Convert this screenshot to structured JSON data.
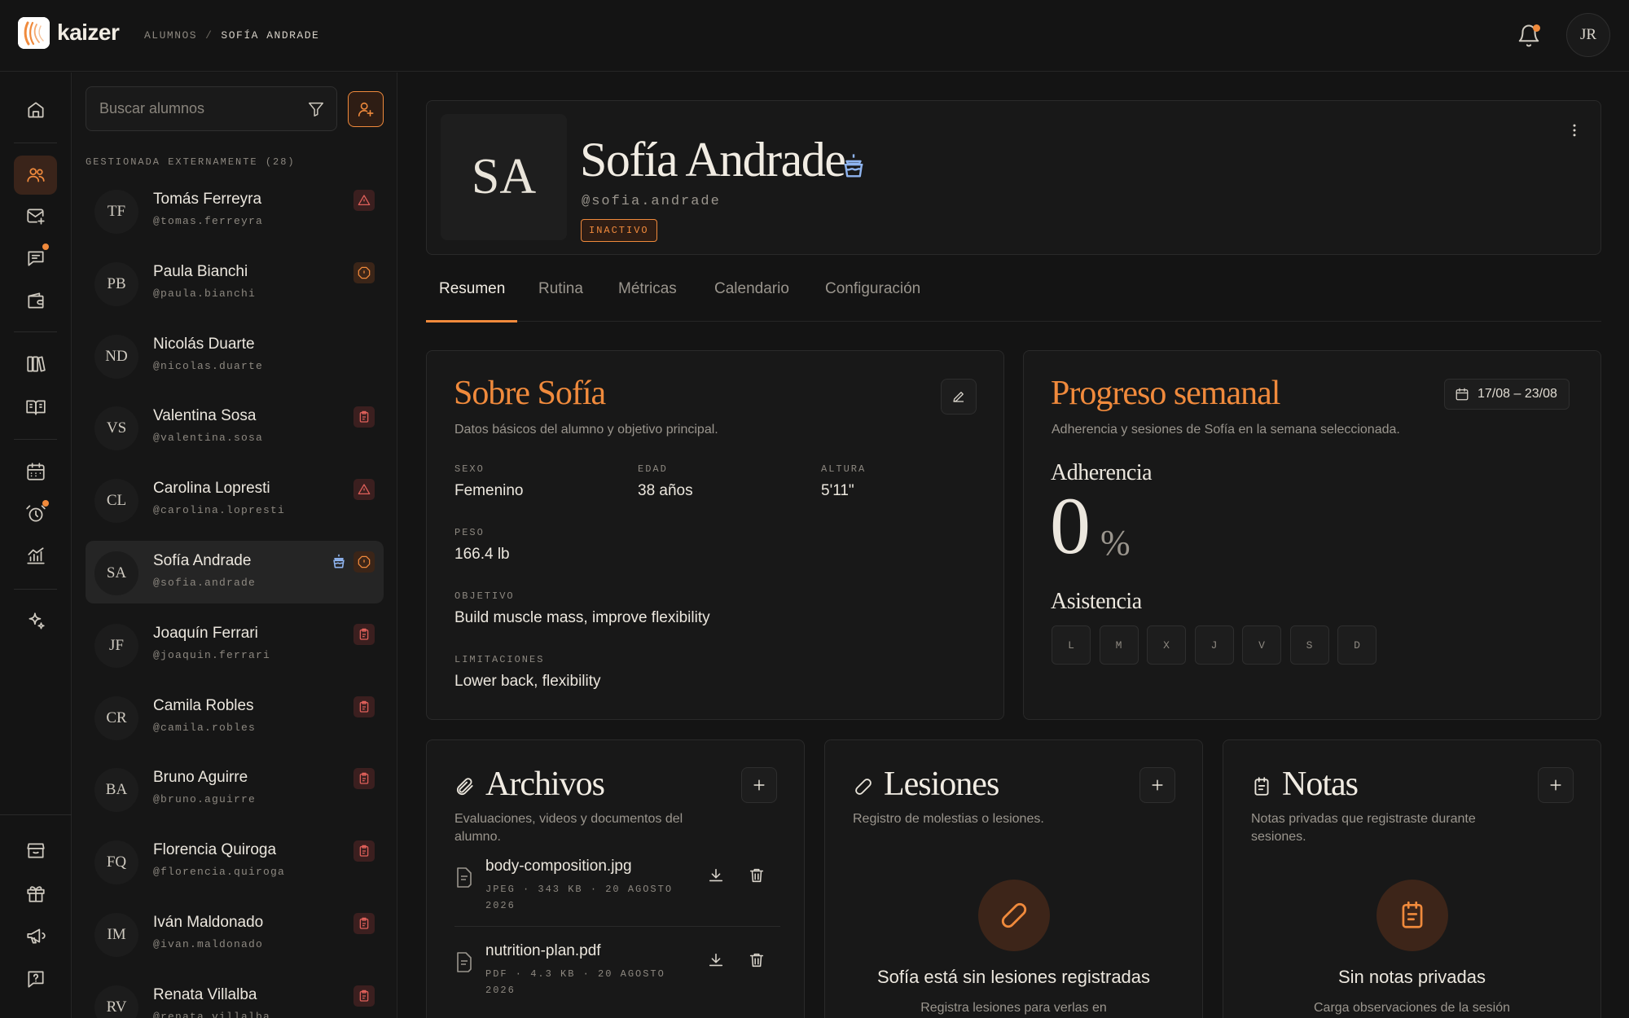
{
  "app": {
    "logo_text": "kaizer",
    "breadcrumb": [
      "ALUMNOS",
      "SOFÍA ANDRADE"
    ],
    "breadcrumb_sep": "/",
    "user_initials": "JR",
    "accent_color": "#f08a3c"
  },
  "rail": {
    "icons": [
      "home-icon",
      "users-icon",
      "mail-plus-icon",
      "chat-icon",
      "wallet-icon",
      "book-icon",
      "book-open-icon",
      "calendar-icon",
      "alarm-icon",
      "chart-icon",
      "sparkle-icon",
      "store-icon",
      "gift-icon",
      "megaphone-icon",
      "help-icon"
    ]
  },
  "students": {
    "search_placeholder": "Buscar alumnos",
    "section_label": "GESTIONADA EXTERNAMENTE (28)",
    "items": [
      {
        "initials": "TF",
        "name": "Tomás Ferreyra",
        "handle": "@tomas.ferreyra",
        "badge": "warning-icon"
      },
      {
        "initials": "PB",
        "name": "Paula Bianchi",
        "handle": "@paula.bianchi",
        "badge": "alert-icon"
      },
      {
        "initials": "ND",
        "name": "Nicolás Duarte",
        "handle": "@nicolas.duarte",
        "badge": ""
      },
      {
        "initials": "VS",
        "name": "Valentina Sosa",
        "handle": "@valentina.sosa",
        "badge": "clipboard-icon"
      },
      {
        "initials": "CL",
        "name": "Carolina Lopresti",
        "handle": "@carolina.lopresti",
        "badge": "warning-icon"
      },
      {
        "initials": "SA",
        "name": "Sofía Andrade",
        "handle": "@sofia.andrade",
        "badge": "alert-icon",
        "birthday": true,
        "selected": true
      },
      {
        "initials": "JF",
        "name": "Joaquín Ferrari",
        "handle": "@joaquin.ferrari",
        "badge": "clipboard-icon"
      },
      {
        "initials": "CR",
        "name": "Camila Robles",
        "handle": "@camila.robles",
        "badge": "clipboard-icon"
      },
      {
        "initials": "BA",
        "name": "Bruno Aguirre",
        "handle": "@bruno.aguirre",
        "badge": "clipboard-icon"
      },
      {
        "initials": "FQ",
        "name": "Florencia Quiroga",
        "handle": "@florencia.quiroga",
        "badge": "clipboard-icon"
      },
      {
        "initials": "IM",
        "name": "Iván Maldonado",
        "handle": "@ivan.maldonado",
        "badge": "clipboard-icon"
      },
      {
        "initials": "RV",
        "name": "Renata Villalba",
        "handle": "@renata.villalba",
        "badge": "clipboard-icon"
      }
    ]
  },
  "profile": {
    "initials": "SA",
    "name": "Sofía Andrade",
    "handle": "@sofia.andrade",
    "status": "INACTIVO"
  },
  "tabs": [
    "Resumen",
    "Rutina",
    "Métricas",
    "Calendario",
    "Configuración"
  ],
  "about": {
    "title": "Sobre Sofía",
    "subtitle": "Datos básicos del alumno y objetivo principal.",
    "fields": [
      {
        "label": "SEXO",
        "value": "Femenino"
      },
      {
        "label": "EDAD",
        "value": "38 años"
      },
      {
        "label": "ALTURA",
        "value": "5'11\""
      },
      {
        "label": "PESO",
        "value": "166.4 lb"
      },
      {
        "label": "OBJETIVO",
        "value": "Build muscle mass, improve flexibility"
      },
      {
        "label": "LIMITACIONES",
        "value": "Lower back, flexibility"
      }
    ]
  },
  "progress": {
    "title": "Progreso semanal",
    "subtitle": "Adherencia y sesiones de Sofía en la semana seleccionada.",
    "date_range": "17/08 – 23/08",
    "adherence_label": "Adherencia",
    "adherence_value": "0",
    "adherence_unit": "%",
    "attendance_label": "Asistencia",
    "days": [
      "L",
      "M",
      "X",
      "J",
      "V",
      "S",
      "D"
    ]
  },
  "files": {
    "title": "Archivos",
    "subtitle": "Evaluaciones, videos y documentos del alumno.",
    "items": [
      {
        "name": "body-composition.jpg",
        "meta": "JPEG · 343 KB · 20 AGOSTO 2026"
      },
      {
        "name": "nutrition-plan.pdf",
        "meta": "PDF · 4.3 KB · 20 AGOSTO 2026"
      }
    ]
  },
  "injuries": {
    "title": "Lesiones",
    "subtitle": "Registro de molestias o lesiones.",
    "empty_title": "Sofía está sin lesiones registradas",
    "empty_sub": "Registra lesiones para verlas en"
  },
  "notes": {
    "title": "Notas",
    "subtitle": "Notas privadas que registraste durante sesiones.",
    "empty_title": "Sin notas privadas",
    "empty_sub": "Carga observaciones de la sesión"
  }
}
